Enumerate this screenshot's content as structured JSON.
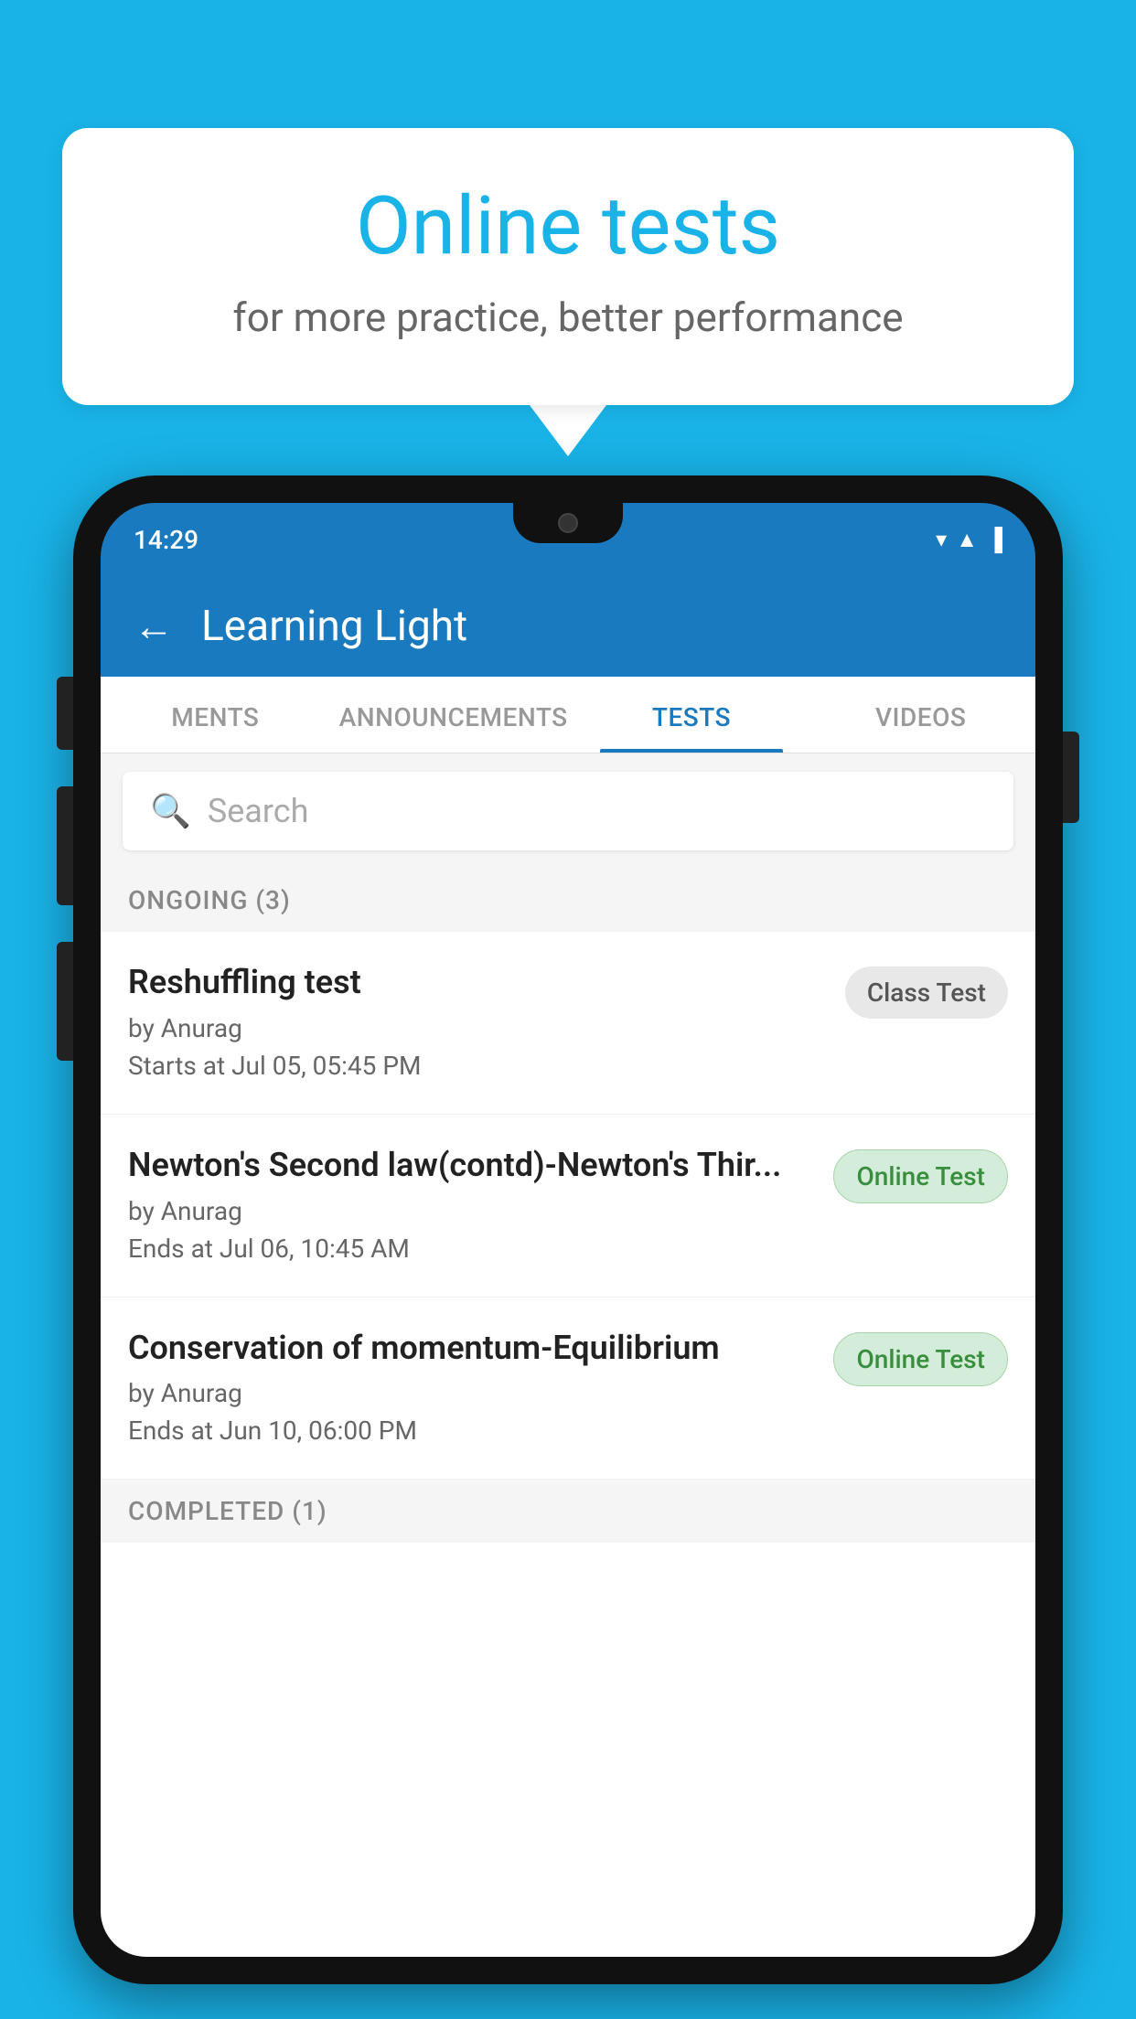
{
  "background_color": "#1ab3e8",
  "speech_bubble": {
    "title": "Online tests",
    "subtitle": "for more practice, better performance"
  },
  "phone": {
    "status_bar": {
      "time": "14:29",
      "wifi_icon": "▾",
      "signal_icon": "▲",
      "battery_icon": "▐"
    },
    "header": {
      "title": "Learning Light",
      "back_label": "←"
    },
    "tabs": [
      {
        "label": "MENTS",
        "active": false
      },
      {
        "label": "ANNOUNCEMENTS",
        "active": false
      },
      {
        "label": "TESTS",
        "active": true
      },
      {
        "label": "VIDEOS",
        "active": false
      }
    ],
    "search": {
      "placeholder": "Search"
    },
    "ongoing_section": {
      "label": "ONGOING (3)",
      "tests": [
        {
          "title": "Reshuffling test",
          "author": "by Anurag",
          "date": "Starts at  Jul 05, 05:45 PM",
          "badge": "Class Test",
          "badge_type": "class"
        },
        {
          "title": "Newton's Second law(contd)-Newton's Thir...",
          "author": "by Anurag",
          "date": "Ends at  Jul 06, 10:45 AM",
          "badge": "Online Test",
          "badge_type": "online"
        },
        {
          "title": "Conservation of momentum-Equilibrium",
          "author": "by Anurag",
          "date": "Ends at  Jun 10, 06:00 PM",
          "badge": "Online Test",
          "badge_type": "online"
        }
      ]
    },
    "completed_section": {
      "label": "COMPLETED (1)"
    }
  }
}
